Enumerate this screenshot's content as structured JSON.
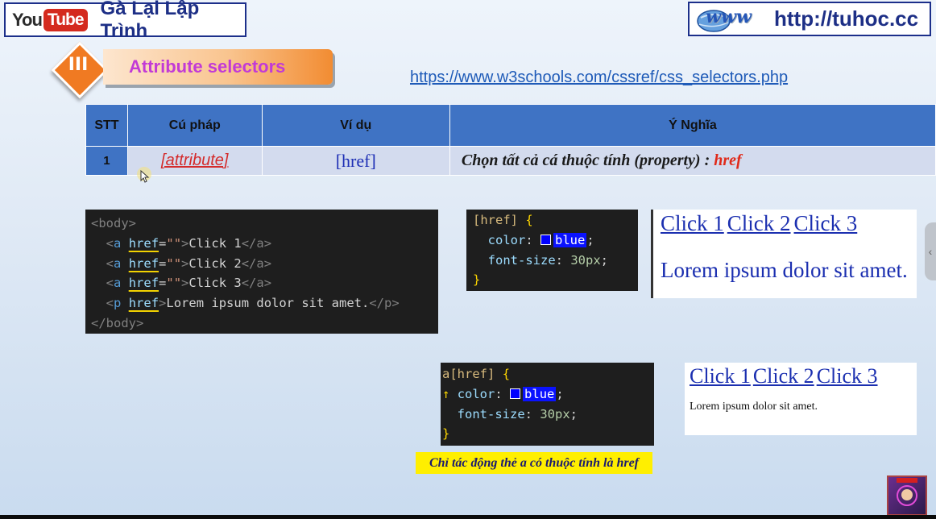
{
  "header": {
    "youtube_logo_you": "You",
    "youtube_logo_tube": "Tube",
    "channel_name": "Gà Lại Lập Trình",
    "site_logo_text": "www",
    "site_url": "http://tuhoc.cc"
  },
  "section": {
    "number": "III",
    "title": "Attribute selectors"
  },
  "reference_link": "https://www.w3schools.com/cssref/css_selectors.php",
  "table": {
    "headers": [
      "STT",
      "Cú pháp",
      "Ví dụ",
      "Ý Nghĩa"
    ],
    "rows": [
      {
        "stt": "1",
        "syntax": "[attribute]",
        "example": "[href]",
        "meaning": "Chọn tất cả cá thuộc tính (property) : ",
        "meaning_highlight": "href"
      }
    ]
  },
  "code_html": {
    "lines": [
      {
        "open": "<body>"
      },
      {
        "tag": "a",
        "attr": "href",
        "value": "\"\"",
        "text": "Click 1",
        "close": "</a>"
      },
      {
        "tag": "a",
        "attr": "href",
        "value": "\"\"",
        "text": "Click 2",
        "close": "</a>"
      },
      {
        "tag": "a",
        "attr": "href",
        "value": "\"\"",
        "text": "Click 3",
        "close": "</a>"
      },
      {
        "tag": "p",
        "attr": "href",
        "text": "Lorem ipsum dolor sit amet.",
        "close": "</p>"
      },
      {
        "close_body": "</body>"
      }
    ]
  },
  "code_css_1": {
    "selector": "[href]",
    "brace_open": "{",
    "prop1": "color",
    "val1": "blue",
    "prop2": "font-size",
    "val2": "30px",
    "brace_close": "}"
  },
  "code_css_2": {
    "selector_tag": "a",
    "selector_attr": "[href]",
    "brace_open": "{",
    "prop1": "color",
    "val1": "blue",
    "prop2": "font-size",
    "val2": "30px",
    "brace_close": "}"
  },
  "preview_1": {
    "links": [
      "Click 1",
      "Click 2",
      "Click 3"
    ],
    "paragraph": "Lorem ipsum dolor sit amet."
  },
  "preview_2": {
    "links": [
      "Click 1",
      "Click 2",
      "Click 3"
    ],
    "paragraph": "Lorem ipsum dolor sit amet."
  },
  "note": "Chỉ tác động thẻ a có thuộc tính là href",
  "icons": {
    "cursor": "mouse-pointer-icon",
    "side_tab": "chevron-left-icon",
    "avatar": "channel-avatar"
  },
  "colors": {
    "table_header": "#3f73c4",
    "table_row": "#d3dbee",
    "section_accent": "#f07a22",
    "note_bg": "#ffef00",
    "code_bg": "#1e1e1e"
  }
}
